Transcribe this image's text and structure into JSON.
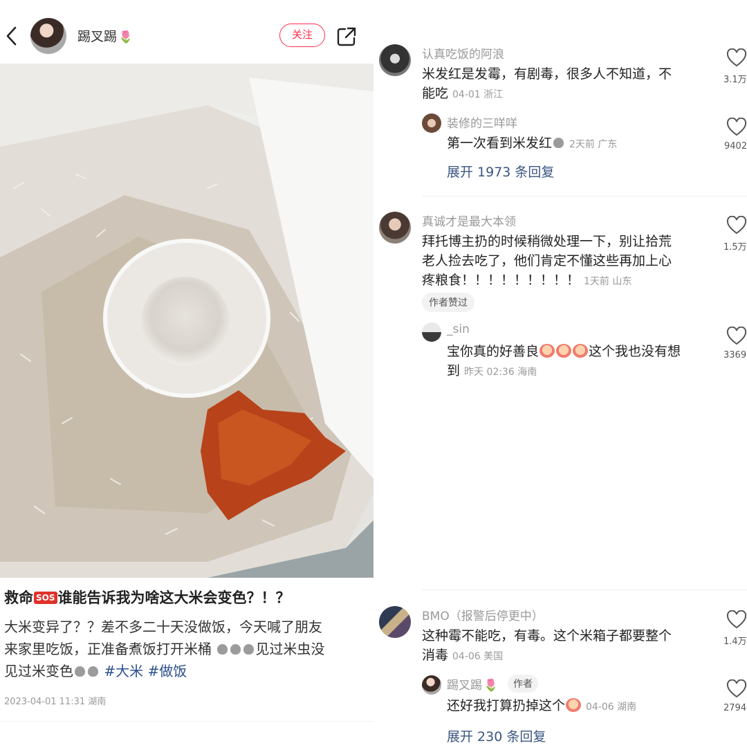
{
  "post": {
    "author": "踢叉踢",
    "author_flower": "🌷",
    "follow_label": "关注",
    "title_pre": "救命",
    "title_sos": "SOS",
    "title_post": "谁能告诉我为啥这大米会变色？！？",
    "body_line1": "大米变异了？？差不多二十天没做饭，今天喊了朋友",
    "body_line2": "来家里吃饭，正准备煮饭打开米桶",
    "body_line2b": "见过米虫没",
    "body_line3": "见过米变色",
    "tag1": "#大米",
    "tag2": "#做饭",
    "date": "2023-04-01 11:31 湖南"
  },
  "comments": [
    {
      "name": "认真吃饭的阿浪",
      "text_line1": "米发红是发霉，有剧毒，很多人不知道，不",
      "text_line2": "能吃",
      "meta": "04-01 浙江",
      "likes": "3.1万"
    },
    {
      "name": "装修的三咩咩",
      "text": "第一次看到米发红",
      "meta": "2天前 广东",
      "likes": "9402"
    },
    {
      "expand": "展开 1973 条回复"
    },
    {
      "name": "真诚才是最大本领",
      "text_line1": "拜托博主扔的时候稍微处理一下，别让拾荒",
      "text_line2": "老人捡去吃了，他们肯定不懂这些再加上心",
      "text_line3": "疼粮食！！！！！！！！！",
      "meta": "1天前 山东",
      "likes": "1.5万",
      "badge": "作者赞过"
    },
    {
      "name": "_sin",
      "text_line1a": "宝你真的好善良",
      "text_line1b": "这个我也没有想",
      "text_line2": "到",
      "meta": "昨天 02:36 海南",
      "likes": "3369"
    },
    {
      "name": "BMO（报警后停更中）",
      "text_line1": "这种霉不能吃，有毒。这个米箱子都要整个",
      "text_line2": "消毒",
      "meta": "04-06 美国",
      "likes": "1.4万"
    },
    {
      "name": "踢叉踢",
      "name_flower": "🌷",
      "badge": "作者",
      "text": "还好我打算扔掉这个",
      "meta": "04-06 湖南",
      "likes": "2794"
    },
    {
      "expand": "展开 230 条回复"
    }
  ],
  "colors": {
    "accent": "#ff2e4d",
    "link": "#3a5580",
    "tag": "#2b4f8c",
    "mold": "#b8431a"
  },
  "icons": [
    "chevron-left-icon",
    "share-icon",
    "heart-icon",
    "poop-emoji-icon",
    "crying-face-icon",
    "sos-icon"
  ]
}
